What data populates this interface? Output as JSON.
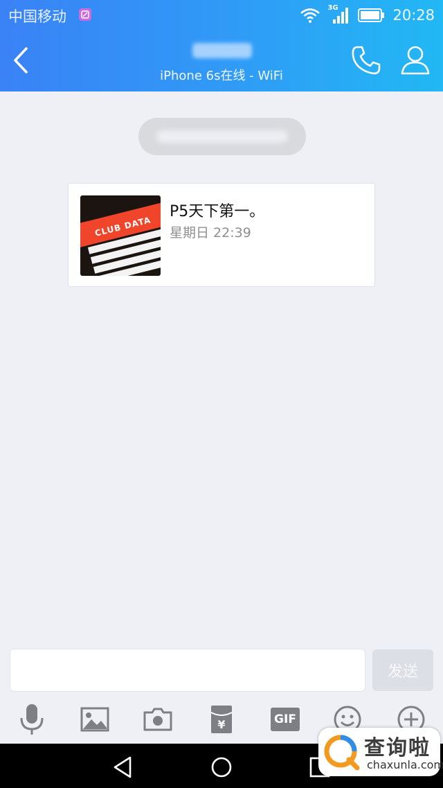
{
  "status_bar": {
    "carrier": "中国移动",
    "network_type": "3G",
    "time": "20:28"
  },
  "nav": {
    "subtitle": "iPhone 6s在线 - WiFi"
  },
  "message": {
    "title": "P5天下第一。",
    "time": "星期日 22:39",
    "thumbnail_text": "CLUB DATA"
  },
  "input": {
    "placeholder": "",
    "send_label": "发送"
  },
  "toolbar": {
    "gif_label": "GIF"
  },
  "watermark": {
    "brand_cn": "查询啦",
    "brand_en": "chaxunla.com"
  },
  "colors": {
    "header_start": "#3a82f6",
    "header_end": "#22b8f4",
    "icon_gray": "#7d7f85",
    "background": "#eef0f5"
  },
  "icons": [
    "back-icon",
    "phone-icon",
    "profile-icon",
    "mic-icon",
    "image-icon",
    "camera-icon",
    "red-packet-icon",
    "gif-icon",
    "emoji-icon",
    "plus-icon",
    "wifi-icon",
    "signal-icon",
    "battery-icon",
    "android-back-icon",
    "android-home-icon",
    "android-recents-icon"
  ]
}
